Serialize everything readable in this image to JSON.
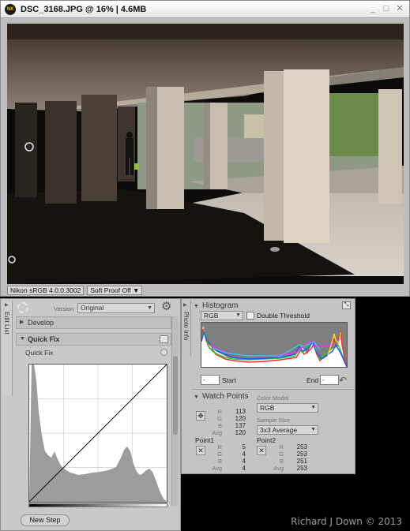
{
  "window": {
    "title": "DSC_3168.JPG @ 16% | 4.6MB",
    "logo_text": "NX",
    "minimize_glyph": "_",
    "maximize_glyph": "□",
    "close_glyph": "✕"
  },
  "status_bar": {
    "profile": "Nikon sRGB 4.0.0.3002",
    "soft_proof": "Soft Proof Off"
  },
  "edit_list": {
    "tab_label": "Edit List",
    "version_label": "Version",
    "version_value": "Original",
    "develop_label": "Develop",
    "quick_fix_label": "Quick Fix",
    "quick_fix_sub": "Quick Fix",
    "new_step_label": "New Step"
  },
  "photo_info": {
    "tab_label": "Photo Info",
    "histogram_label": "Histogram",
    "channel_value": "RGB",
    "double_threshold_label": "Double Threshold",
    "start_value": "-",
    "start_label": "Start",
    "end_label": "End",
    "end_value": "-",
    "watch_points_label": "Watch Points",
    "color_model_label": "Color Model",
    "color_model_value": "RGB",
    "sample_size_label": "Sample Size",
    "sample_size_value": "3x3 Average",
    "active_point": {
      "R": "113",
      "G": "120",
      "B": "137",
      "Avg": "120"
    },
    "point1": {
      "label": "Point1",
      "R": "5",
      "G": "4",
      "B": "4",
      "Avg": "4"
    },
    "point2": {
      "label": "Point2",
      "R": "253",
      "G": "253",
      "B": "251",
      "Avg": "253"
    },
    "channel_labels": {
      "r": "R",
      "g": "G",
      "b": "B",
      "avg": "Avg"
    }
  },
  "watermark": "Richard J Down © 2013",
  "icons": [
    "nx-logo-icon",
    "gear-icon",
    "dropdown-arrow-icon",
    "reset-icon",
    "eyedropper-target-icon",
    "delete-point-icon"
  ]
}
